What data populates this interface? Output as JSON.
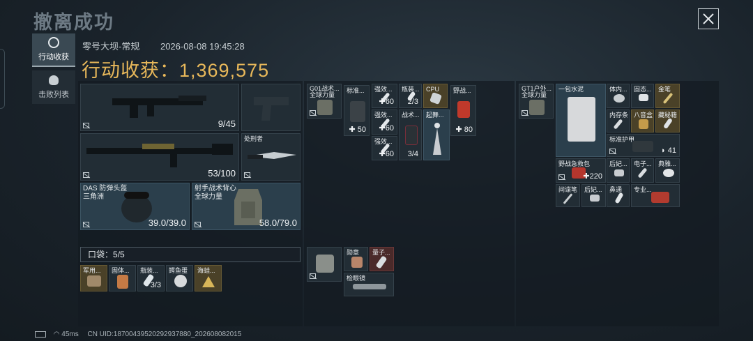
{
  "header": {
    "title": "撤离成功",
    "close_icon": "close-icon"
  },
  "tabs": [
    {
      "label": "行动收获",
      "icon": "loot-icon",
      "active": true
    },
    {
      "label": "击败列表",
      "icon": "skull-icon",
      "active": false
    }
  ],
  "meta": {
    "map": "零号大坝-常规",
    "datetime": "2026-08-08 19:45:28"
  },
  "gain": {
    "label": "行动收获：",
    "value": "1,369,575"
  },
  "equipment": {
    "primary_count": "9/45",
    "secondary_count": "53/100",
    "melee_label": "处刑者",
    "helmet_label": "DAS 防弹头盔",
    "helmet_brand": "三角洲",
    "helmet_durability": "39.0/39.0",
    "vest_label": "射手战术背心",
    "vest_brand": "全球力量",
    "vest_durability": "58.0/79.0"
  },
  "pocket": {
    "label": "口袋：",
    "count": "5/5",
    "items": [
      "军用...",
      "固体...",
      "瓶装...",
      "鳄鱼蛋",
      "海蛙..."
    ],
    "flask_count": "3/3"
  },
  "bag1": {
    "name": "G01战术...",
    "brand": "全球力量",
    "items": [
      {
        "label": "标准...",
        "count": "50"
      },
      {
        "label": "强效...",
        "count": "60"
      },
      {
        "label": "瓶装...",
        "count": "2/3"
      },
      {
        "label": "CPU",
        "count": ""
      },
      {
        "label": "野战...",
        "count": "80"
      },
      {
        "label": "强效...",
        "count": "60"
      },
      {
        "label": "战术...",
        "count": "3/4"
      },
      {
        "label": "起舞...",
        "count": ""
      },
      {
        "label": "强效...",
        "count": "60"
      }
    ]
  },
  "bag2": {
    "items": [
      {
        "label": "勋章",
        "count": ""
      },
      {
        "label": "量子...",
        "count": ""
      },
      {
        "label": "检眼镜",
        "count": ""
      }
    ]
  },
  "bag3": {
    "name": "GT1户外...",
    "brand": "全球力量",
    "items": [
      {
        "label": "一包水泥",
        "count": ""
      },
      {
        "label": "体内...",
        "count": ""
      },
      {
        "label": "固态...",
        "count": ""
      },
      {
        "label": "金笔",
        "count": ""
      },
      {
        "label": "内存条",
        "count": ""
      },
      {
        "label": "八音盒",
        "count": ""
      },
      {
        "label": "藏秘籍",
        "count": ""
      },
      {
        "label": "标准护甲...",
        "count": "41"
      },
      {
        "label": "野战急救包",
        "count": "220"
      },
      {
        "label": "后妃...",
        "count": ""
      },
      {
        "label": "电子...",
        "count": ""
      },
      {
        "label": "典雅...",
        "count": ""
      },
      {
        "label": "间谍笔",
        "count": ""
      },
      {
        "label": "后妃...",
        "count": ""
      },
      {
        "label": "鼻通",
        "count": ""
      },
      {
        "label": "专业...",
        "count": ""
      }
    ]
  },
  "status": {
    "ping": "45ms",
    "uid": "CN UID:18700439520292937880_20260808201​5"
  }
}
